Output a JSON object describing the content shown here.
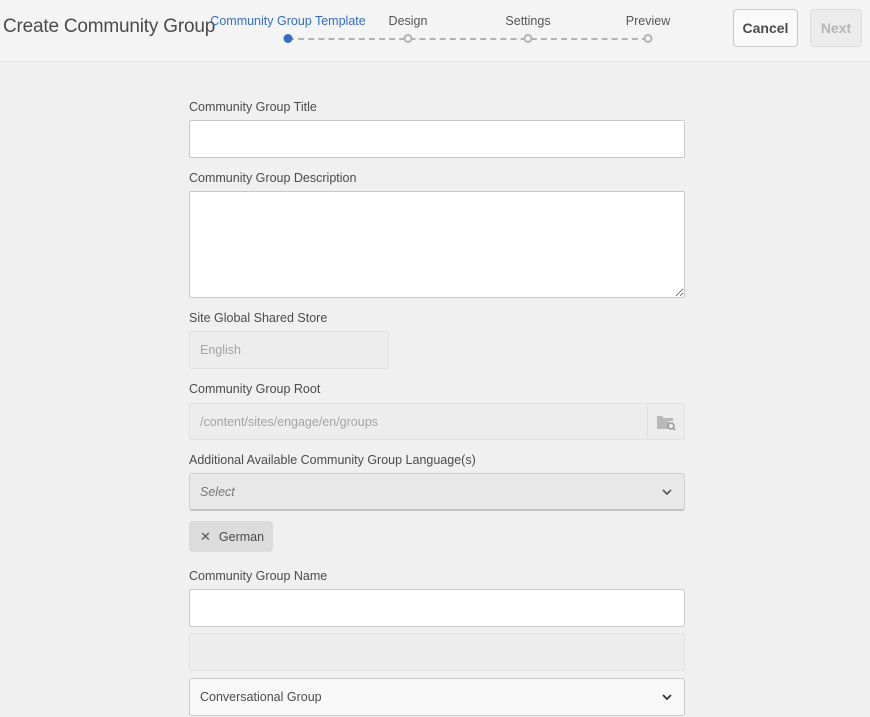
{
  "header": {
    "title": "Create Community Group",
    "cancel_label": "Cancel",
    "next_label": "Next"
  },
  "wizard": {
    "steps": [
      {
        "label": "Community Group Template",
        "active": true
      },
      {
        "label": "Design",
        "active": false
      },
      {
        "label": "Settings",
        "active": false
      },
      {
        "label": "Preview",
        "active": false
      }
    ]
  },
  "form": {
    "title_label": "Community Group Title",
    "title_value": "",
    "description_label": "Community Group Description",
    "description_value": "",
    "store_label": "Site Global Shared Store",
    "store_value": "English",
    "root_label": "Community Group Root",
    "root_value": "/content/sites/engage/en/groups",
    "languages_label": "Additional Available Community Group Language(s)",
    "languages_placeholder": "Select",
    "language_tags": [
      "German"
    ],
    "name_label": "Community Group Name",
    "name_value": "",
    "type_value": "Conversational Group"
  },
  "colors": {
    "accent": "#326ec8",
    "background": "#f0f0f0"
  },
  "icons": {
    "browse": "folder-search-icon",
    "dropdown": "chevron-down-icon",
    "remove_tag": "close-icon"
  }
}
